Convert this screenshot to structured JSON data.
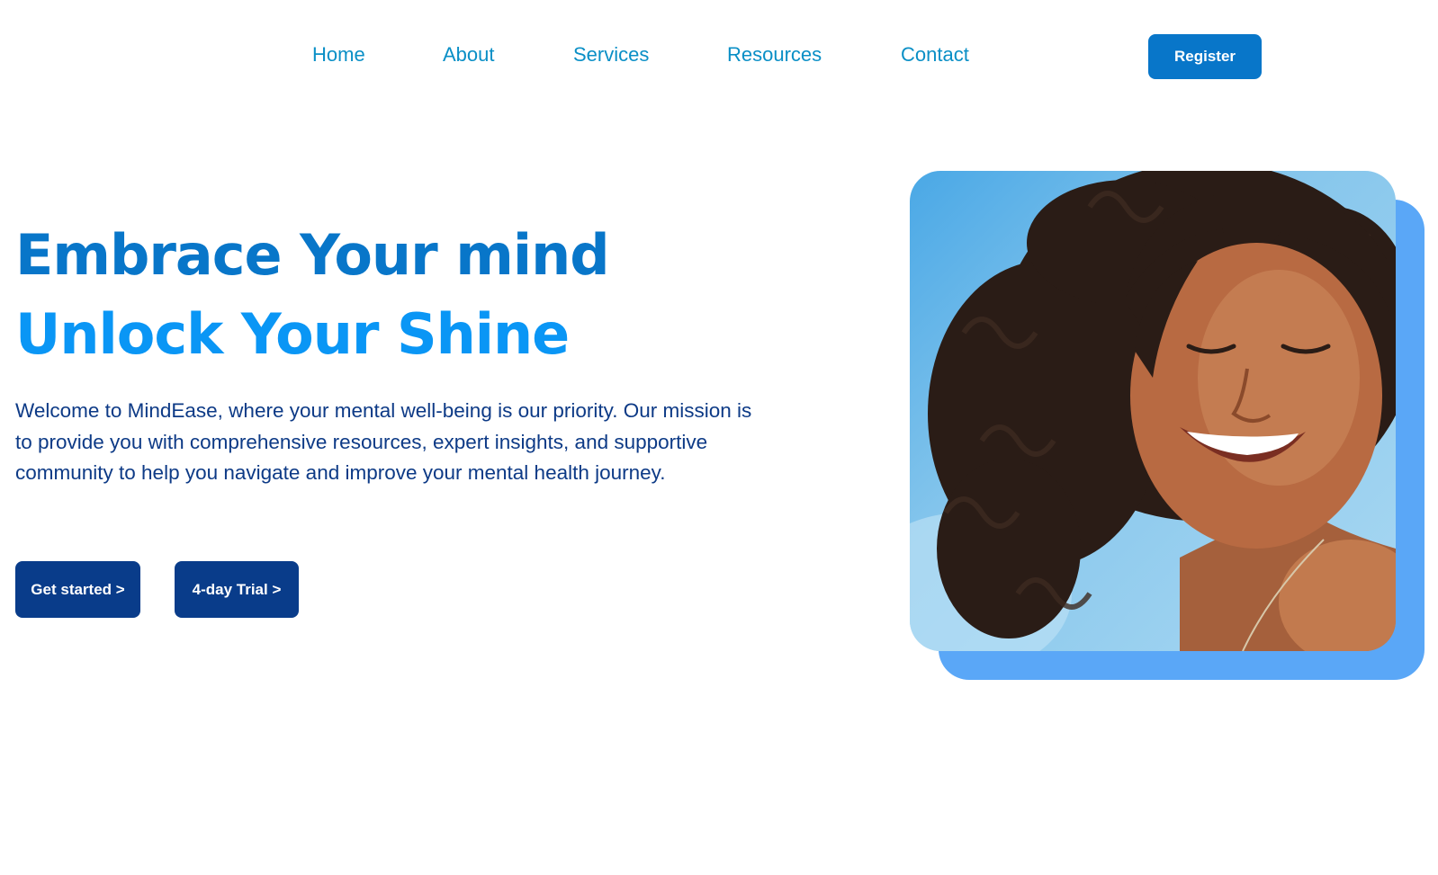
{
  "nav": {
    "links": [
      {
        "label": "Home"
      },
      {
        "label": "About"
      },
      {
        "label": "Services"
      },
      {
        "label": "Resources"
      },
      {
        "label": "Contact"
      }
    ],
    "register_label": "Register"
  },
  "hero": {
    "title_line1": "Embrace Your mind",
    "title_line2": "Unlock Your Shine",
    "description": "Welcome to MindEase, where your mental well-being is our priority. Our mission is to provide you with comprehensive resources, expert insights, and supportive community to help you navigate and improve your mental health journey.",
    "cta_primary": "Get started >",
    "cta_secondary": "4-day Trial >"
  },
  "colors": {
    "nav_link": "#0a8fc6",
    "register_bg": "#0876c9",
    "title_line1": "#0876c9",
    "title_line2": "#0a96f5",
    "description": "#0d3a86",
    "cta_bg": "#093c8a",
    "image_backdrop": "#5aa7f7"
  }
}
